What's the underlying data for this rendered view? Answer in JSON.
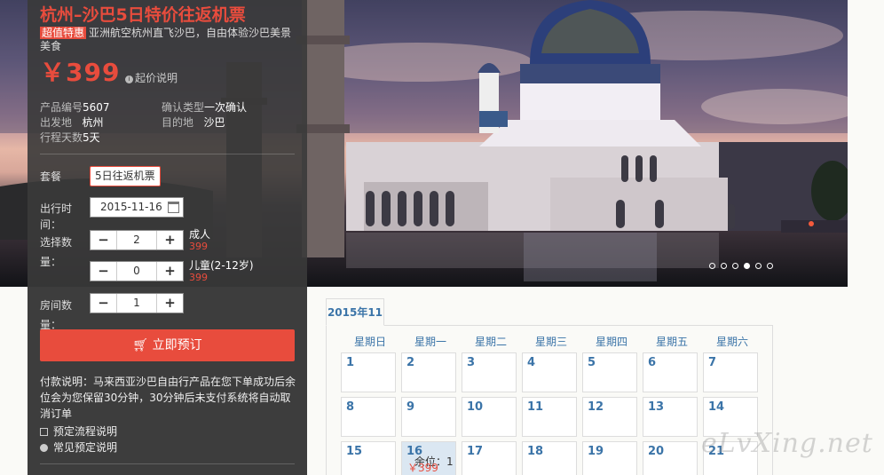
{
  "product": {
    "title": "杭州–沙巴5日特价往返机票",
    "badge": "超值特惠",
    "subtitle": "亚洲航空杭州直飞沙巴，自由体验沙巴美景美食",
    "price": "￥399",
    "price_note": "起价说明",
    "code_label": "产品编号",
    "code": "5607",
    "confirm_label": "确认类型",
    "confirm": "一次确认",
    "from_label": "出发地",
    "from": "杭州",
    "to_label": "目的地",
    "to": "沙巴",
    "days_label": "行程天数",
    "days": "5天"
  },
  "form": {
    "package_label": "套餐",
    "package": "5日往返机票",
    "date_label": "出行时间：",
    "date": "2015-11-16",
    "qty_label": "选择数量：",
    "adult_label": "成人",
    "adult_price": "399",
    "adult_count": "2",
    "child_label": "儿童(2-12岁)",
    "child_price": "399",
    "child_count": "0",
    "rooms_label": "房间数量：",
    "rooms": "1",
    "minus": "−",
    "plus": "+",
    "book_label": "立即预订",
    "payment_note": "付款说明：马来西亚沙巴自由行产品在您下单成功后余位会为您保留30分钟，30分钟后未支付系统将自动取消订单",
    "process_link": "预定流程说明",
    "faq_link": "常见预定说明"
  },
  "calendar": {
    "month": "2015年11",
    "weekdays": [
      "星期日",
      "星期一",
      "星期二",
      "星期三",
      "星期四",
      "星期五",
      "星期六"
    ],
    "days": [
      "1",
      "2",
      "3",
      "4",
      "5",
      "6",
      "7",
      "8",
      "9",
      "10",
      "11",
      "12",
      "13",
      "14",
      "15",
      "16",
      "17",
      "18",
      "19",
      "20",
      "21"
    ],
    "selected": {
      "remain": "余位：1",
      "price": "￥399"
    }
  },
  "carousel": {
    "count": 6,
    "active": 4
  },
  "watermark": "eLvXing.net",
  "colors": {
    "accent": "#e84c3d",
    "link": "#3b74a8"
  }
}
